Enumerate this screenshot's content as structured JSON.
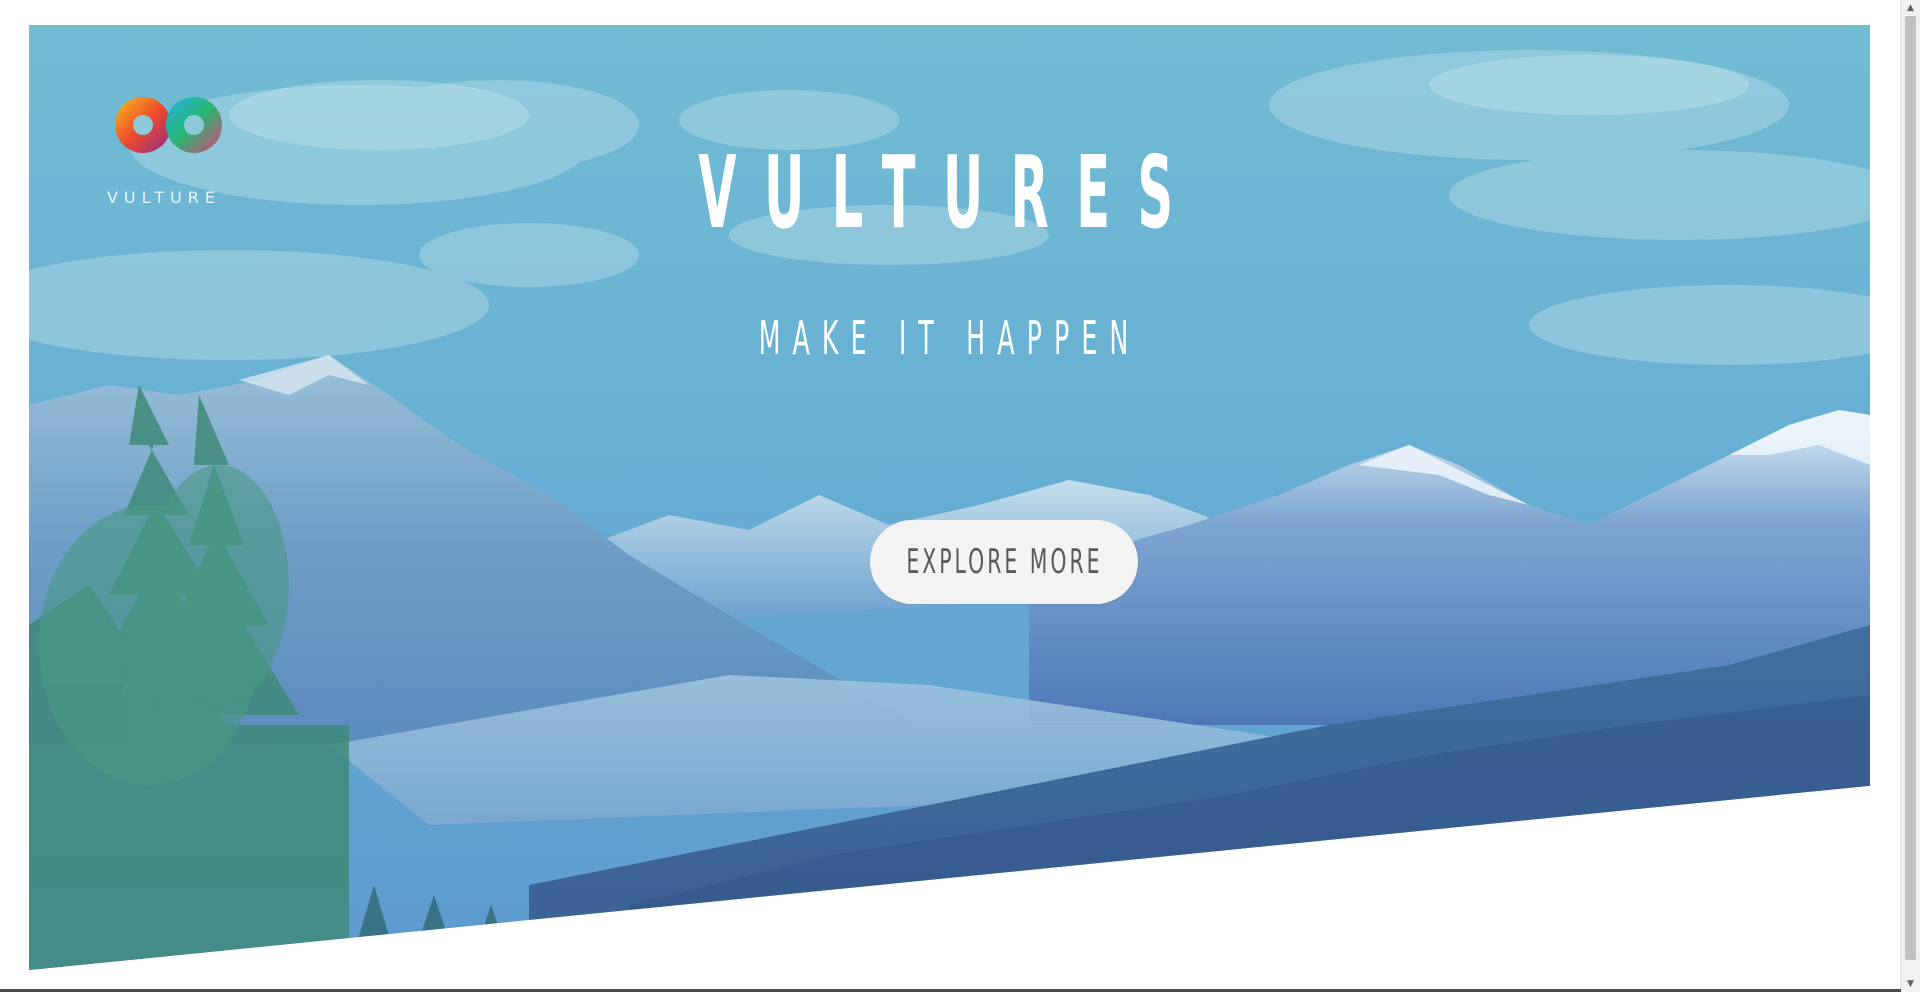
{
  "brand": {
    "name": "VULTURE",
    "logo_icon": "infinity-logo-icon"
  },
  "hero": {
    "title": "VULTURES",
    "subtitle": "MAKE IT HAPPEN",
    "cta_label": "EXPLORE MORE"
  },
  "scrollbar": {
    "up_icon": "chevron-up-icon",
    "down_icon": "chevron-down-icon"
  },
  "colors": {
    "overlay_top": "#6cb9d6",
    "overlay_bottom": "#5070b2",
    "cta_background": "#f3f3f3",
    "cta_text": "#5a5a5a",
    "title_text": "#ffffff"
  }
}
